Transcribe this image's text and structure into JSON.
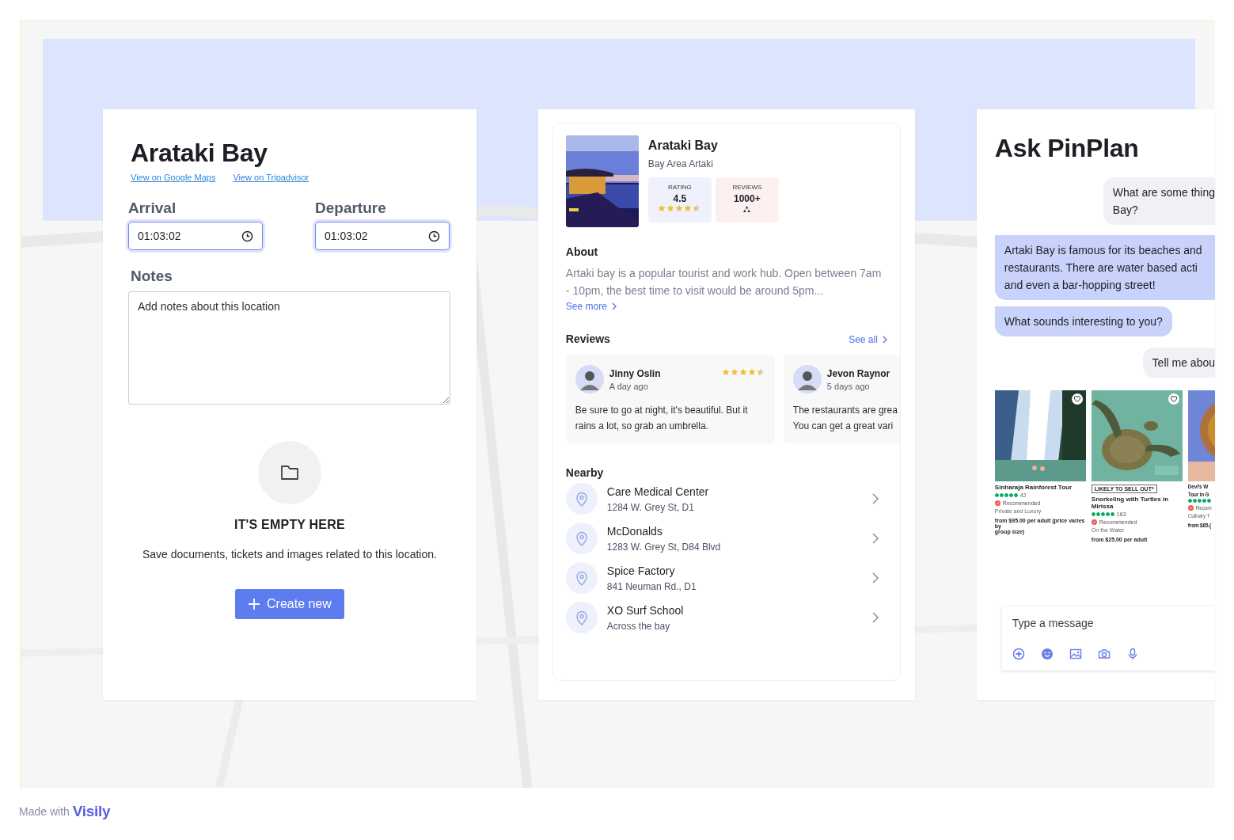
{
  "location_panel": {
    "title": "Arataki Bay",
    "links": [
      "View on Google Maps",
      "View on Tripadvisor"
    ],
    "times": [
      {
        "label": "Arrival",
        "value": "01:03:02"
      },
      {
        "label": "Departure",
        "value": "01:03:02"
      }
    ],
    "notes": {
      "label": "Notes",
      "placeholder": "Add notes about this location"
    },
    "empty_state": {
      "title": "IT'S EMPTY HERE",
      "description": "Save documents, tickets and images related to this location.",
      "button": "Create new"
    }
  },
  "details_panel": {
    "title": "Arataki Bay",
    "subtitle": "Bay Area Artaki",
    "stats": [
      {
        "kind": "rating",
        "label": "RATING",
        "value": "4.5",
        "stars": 4.5
      },
      {
        "kind": "reviews",
        "label": "REVIEWS",
        "value": "1000+"
      }
    ],
    "about": {
      "heading": "About",
      "text": "Artaki bay is a popular tourist and work hub. Open between 7am - 10pm, the best time to visit would be around 5pm...",
      "link": "See more"
    },
    "reviews": {
      "heading": "Reviews",
      "link": "See all",
      "items": [
        {
          "name": "Jinny Oslin",
          "time": "A day ago",
          "stars": 4.5,
          "lines": [
            "Be sure to go at night, it's beautiful. But it",
            "rains a lot, so grab an umbrella."
          ]
        },
        {
          "name": "Jevon Raynor",
          "time": "5 days ago",
          "lines": [
            "The restaurants are grea",
            "You can get a great vari"
          ]
        }
      ]
    },
    "nearby": {
      "heading": "Nearby",
      "items": [
        {
          "name": "Care Medical Center",
          "address": "1284 W. Grey St, D1"
        },
        {
          "name": "McDonalds",
          "address": "1283 W. Grey St, D84 Blvd"
        },
        {
          "name": "Spice Factory",
          "address": "841 Neuman Rd., D1"
        },
        {
          "name": "XO Surf School",
          "address": "Across the bay"
        }
      ]
    }
  },
  "chat_panel": {
    "title": "Ask PinPlan",
    "messages": [
      {
        "kind": "user",
        "lines": [
          "What are some thing",
          "Bay?"
        ]
      },
      {
        "kind": "bot",
        "lines": [
          "Artaki Bay is famous for its beaches and",
          "restaurants. There are water based acti",
          "and even a bar-hopping street!"
        ]
      },
      {
        "kind": "bot",
        "lines": [
          "What sounds interesting to you?"
        ]
      },
      {
        "kind": "user",
        "lines": [
          "Tell me abou"
        ]
      }
    ],
    "tours": [
      {
        "title": [
          "Sinharaja Rainforest Tour"
        ],
        "stars": 5,
        "count": "42",
        "recommended": "Recommended",
        "category": "Private and Luxury",
        "price": [
          "from $95.00 per adult (price varies by",
          "group size)"
        ]
      },
      {
        "badge": "LIKELY TO SELL OUT*",
        "title": [
          "Snorkeling with Turtles in Mirissa"
        ],
        "stars": 5,
        "count": "163",
        "recommended": "Recommended",
        "category": "On the Water",
        "price": [
          "from $25.00 per adult"
        ]
      },
      {
        "title": [
          "Devi's W",
          "Tour in G"
        ],
        "stars": 5,
        "recommended": "Recom",
        "category": "Culinary T",
        "price": [
          "from $85.("
        ]
      }
    ],
    "message_input": {
      "placeholder": "Type a message"
    }
  },
  "footer": {
    "text": "Made with",
    "logo": "Visily"
  }
}
